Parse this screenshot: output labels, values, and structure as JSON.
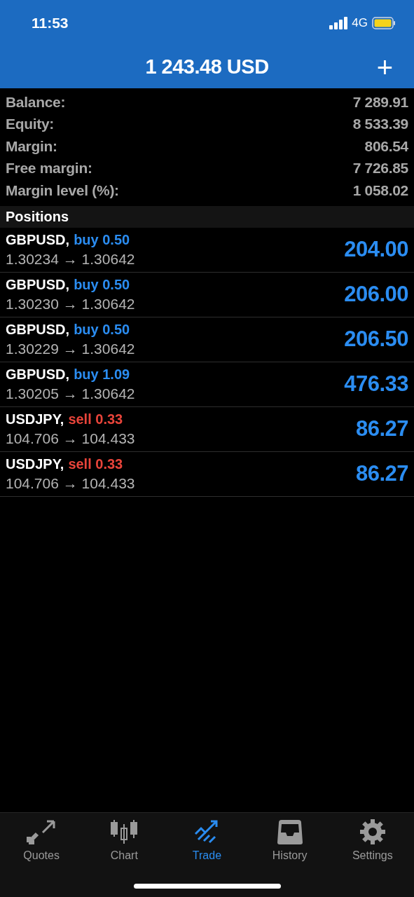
{
  "status_bar": {
    "time": "11:53",
    "network": "4G"
  },
  "header": {
    "title": "1 243.48 USD",
    "add": "+"
  },
  "summary": [
    {
      "label": "Balance:",
      "value": "7 289.91"
    },
    {
      "label": "Equity:",
      "value": "8 533.39"
    },
    {
      "label": "Margin:",
      "value": "806.54"
    },
    {
      "label": "Free margin:",
      "value": "7 726.85"
    },
    {
      "label": "Margin level (%):",
      "value": "1 058.02"
    }
  ],
  "positions_heading": "Positions",
  "positions": [
    {
      "symbol": "GBPUSD,",
      "side": "buy",
      "volume": "0.50",
      "prices": "1.30234 → 1.30642",
      "profit": "204.00"
    },
    {
      "symbol": "GBPUSD,",
      "side": "buy",
      "volume": "0.50",
      "prices": "1.30230 → 1.30642",
      "profit": "206.00"
    },
    {
      "symbol": "GBPUSD,",
      "side": "buy",
      "volume": "0.50",
      "prices": "1.30229 → 1.30642",
      "profit": "206.50"
    },
    {
      "symbol": "GBPUSD,",
      "side": "buy",
      "volume": "1.09",
      "prices": "1.30205 → 1.30642",
      "profit": "476.33"
    },
    {
      "symbol": "USDJPY,",
      "side": "sell",
      "volume": "0.33",
      "prices": "104.706 → 104.433",
      "profit": "86.27"
    },
    {
      "symbol": "USDJPY,",
      "side": "sell",
      "volume": "0.33",
      "prices": "104.706 → 104.433",
      "profit": "86.27"
    }
  ],
  "tabs": [
    {
      "label": "Quotes",
      "kind": "quotes",
      "selected": false
    },
    {
      "label": "Chart",
      "kind": "chart",
      "selected": false
    },
    {
      "label": "Trade",
      "kind": "trade",
      "selected": true
    },
    {
      "label": "History",
      "kind": "history",
      "selected": false
    },
    {
      "label": "Settings",
      "kind": "settings",
      "selected": false
    }
  ]
}
